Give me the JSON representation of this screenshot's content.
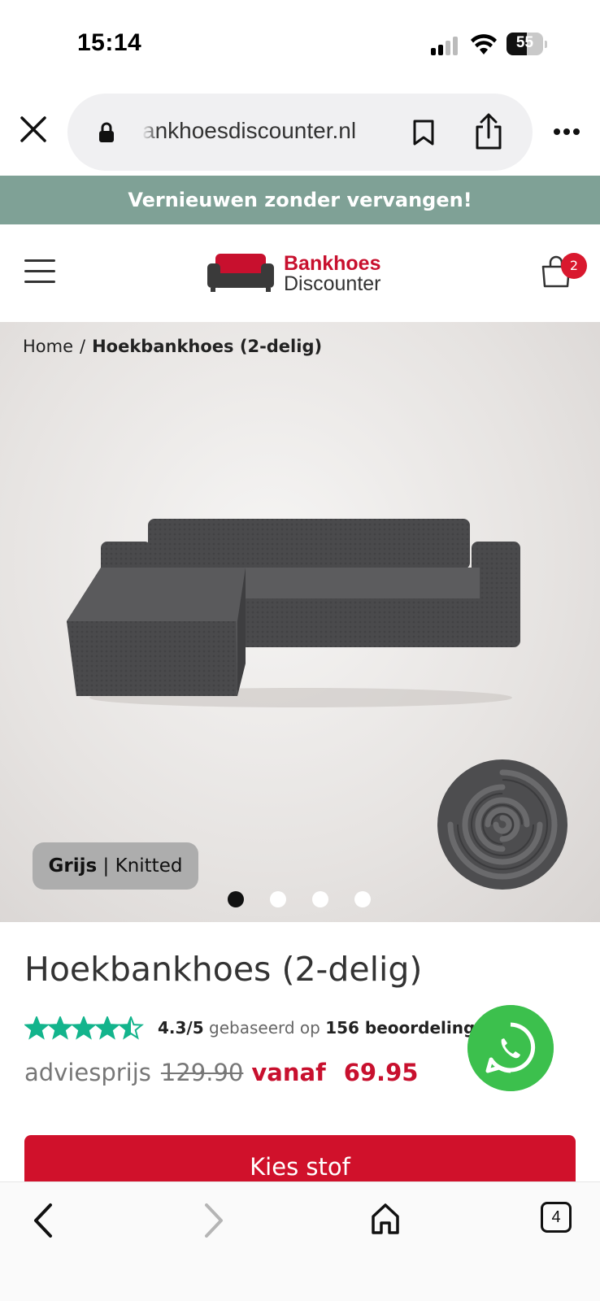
{
  "status_bar": {
    "time": "15:14",
    "battery": "55",
    "battery_level": 0.55
  },
  "browser": {
    "url": "ankhoesdiscounter.nl",
    "tab_count": "4"
  },
  "promo_banner": {
    "text": "Vernieuwen zonder vervangen!",
    "color": "#7fa196"
  },
  "header": {
    "logo_line1": "Bankhoes",
    "logo_line2": "Discounter",
    "cart_count": "2",
    "brand_color": "#c8102e"
  },
  "breadcrumb": {
    "home": "Home",
    "separator": "/",
    "current": "Hoekbankhoes (2-delig)"
  },
  "gallery": {
    "color_name": "Grijs",
    "separator": "|",
    "fabric_name": "Knitted",
    "slide_count": 4,
    "active_slide": 1
  },
  "product": {
    "title": "Hoekbankhoes (2-delig)",
    "rating_stars": 4.5,
    "rating_value": "4.3/5",
    "rating_connector": "gebaseerd op",
    "rating_count": "156 beoordelingen",
    "list_price_label": "adviesprijs",
    "list_price": "129.90",
    "from_label": "vanaf",
    "price": "69.95",
    "cta_label": "Kies stof",
    "star_color": "#13b48c"
  },
  "icons": {
    "close": "close-icon",
    "lock": "lock-icon",
    "bookmark": "bookmark-icon",
    "share": "share-icon",
    "more": "more-icon",
    "menu": "hamburger-icon",
    "cart": "shopping-bag-icon",
    "whatsapp": "whatsapp-icon",
    "back": "chevron-left-icon",
    "forward": "chevron-right-icon",
    "home": "home-icon"
  }
}
